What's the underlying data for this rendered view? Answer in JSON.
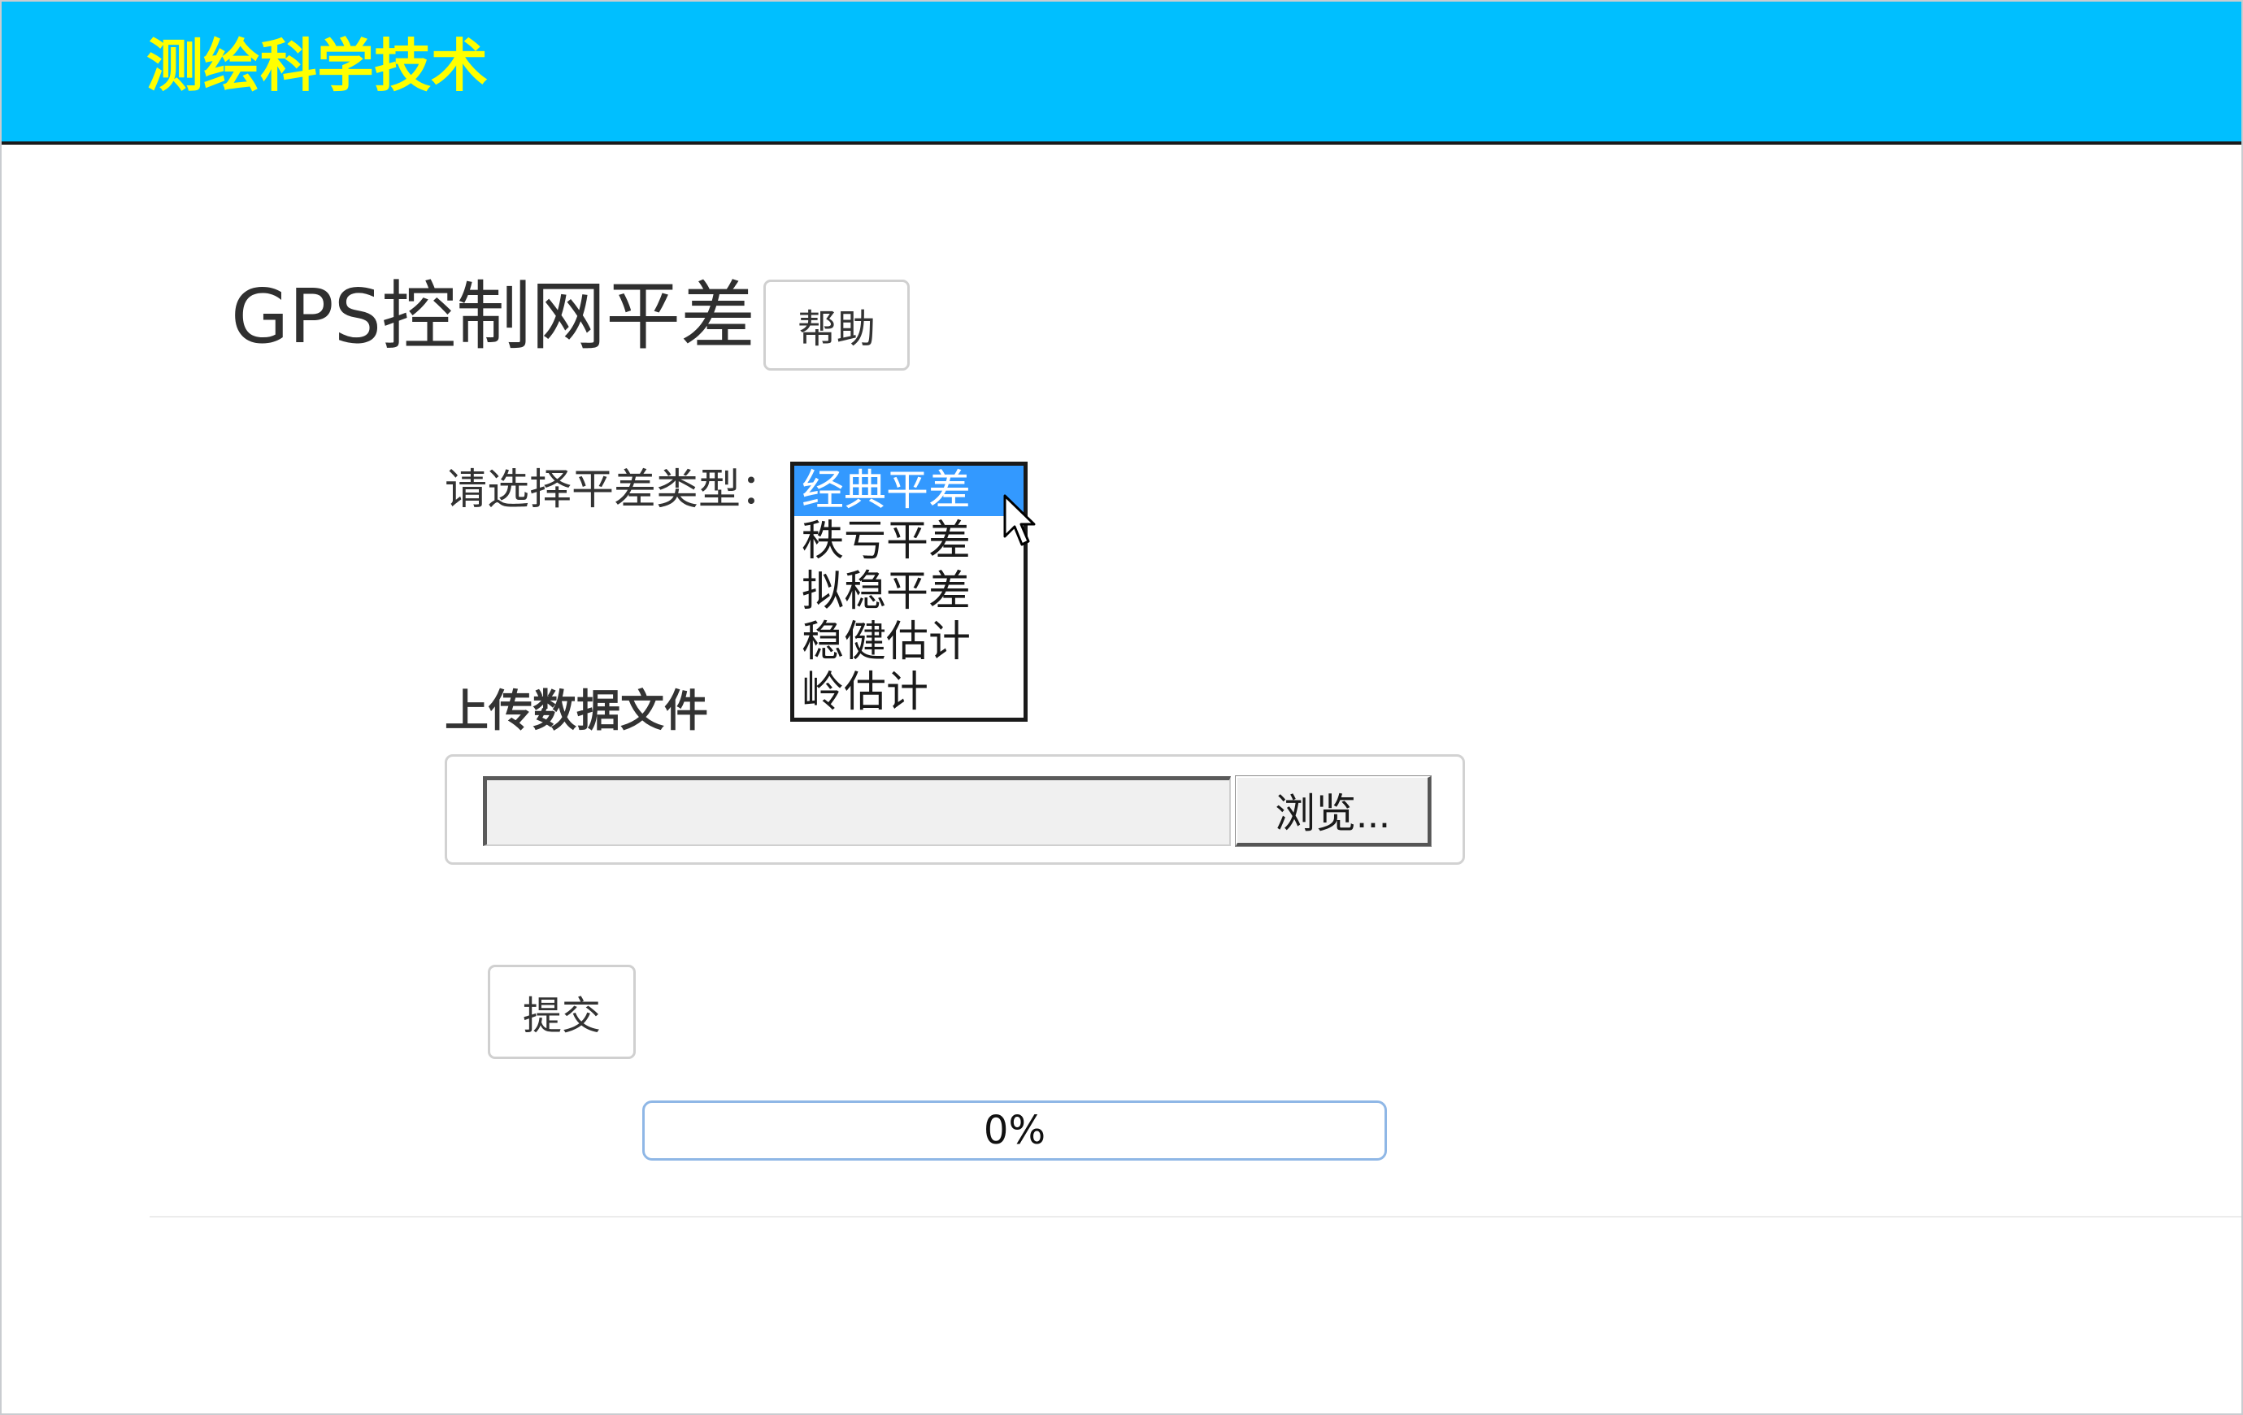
{
  "header": {
    "brand": "测绘科学技术",
    "background_color": "#00bfff",
    "brand_color": "#ffff00"
  },
  "page": {
    "title": "GPS控制网平差",
    "help_label": "帮助"
  },
  "adjustment_type": {
    "label": "请选择平差类型：",
    "options": [
      "经典平差",
      "秩亏平差",
      "拟稳平差",
      "稳健估计",
      "岭估计"
    ],
    "selected": "经典平差",
    "selected_color": "#3399ff"
  },
  "upload": {
    "label": "上传数据文件",
    "file_value": "",
    "browse_label": "浏览..."
  },
  "submit": {
    "label": "提交"
  },
  "progress": {
    "percent": 0,
    "text": "0%"
  }
}
